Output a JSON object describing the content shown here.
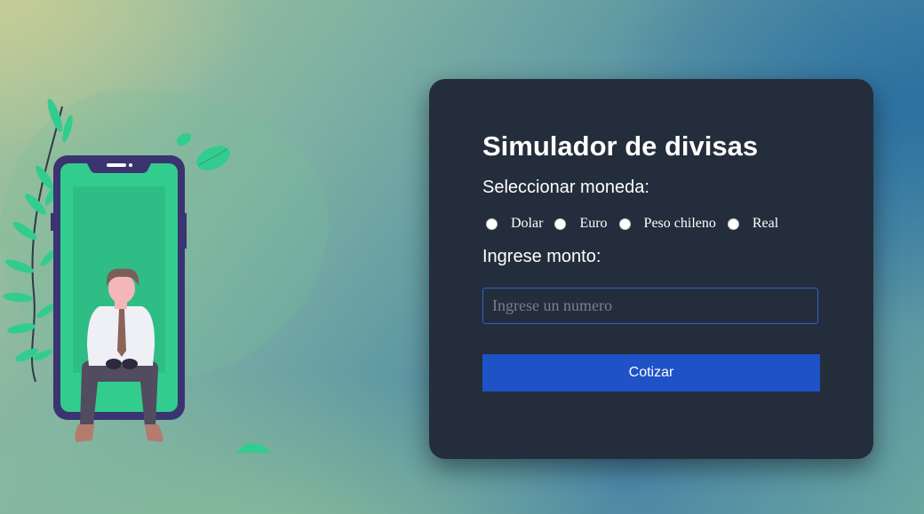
{
  "form": {
    "title": "Simulador de divisas",
    "currency_label": "Seleccionar moneda:",
    "currencies": [
      {
        "label": "Dolar",
        "selected": false
      },
      {
        "label": "Euro",
        "selected": false
      },
      {
        "label": "Peso chileno",
        "selected": false
      },
      {
        "label": "Real",
        "selected": false
      }
    ],
    "amount_label": "Ingrese monto:",
    "amount_input": {
      "value": "",
      "placeholder": "Ingrese un numero"
    },
    "submit_label": "Cotizar"
  },
  "colors": {
    "card_background": "#242d3b",
    "button": "#1f52c7",
    "input_border": "#2f5fd0",
    "illustration_green": "#33cc8f",
    "phone_frame": "#3a3470"
  },
  "illustration": {
    "icon": "person-sitting-on-phone-illustration"
  }
}
